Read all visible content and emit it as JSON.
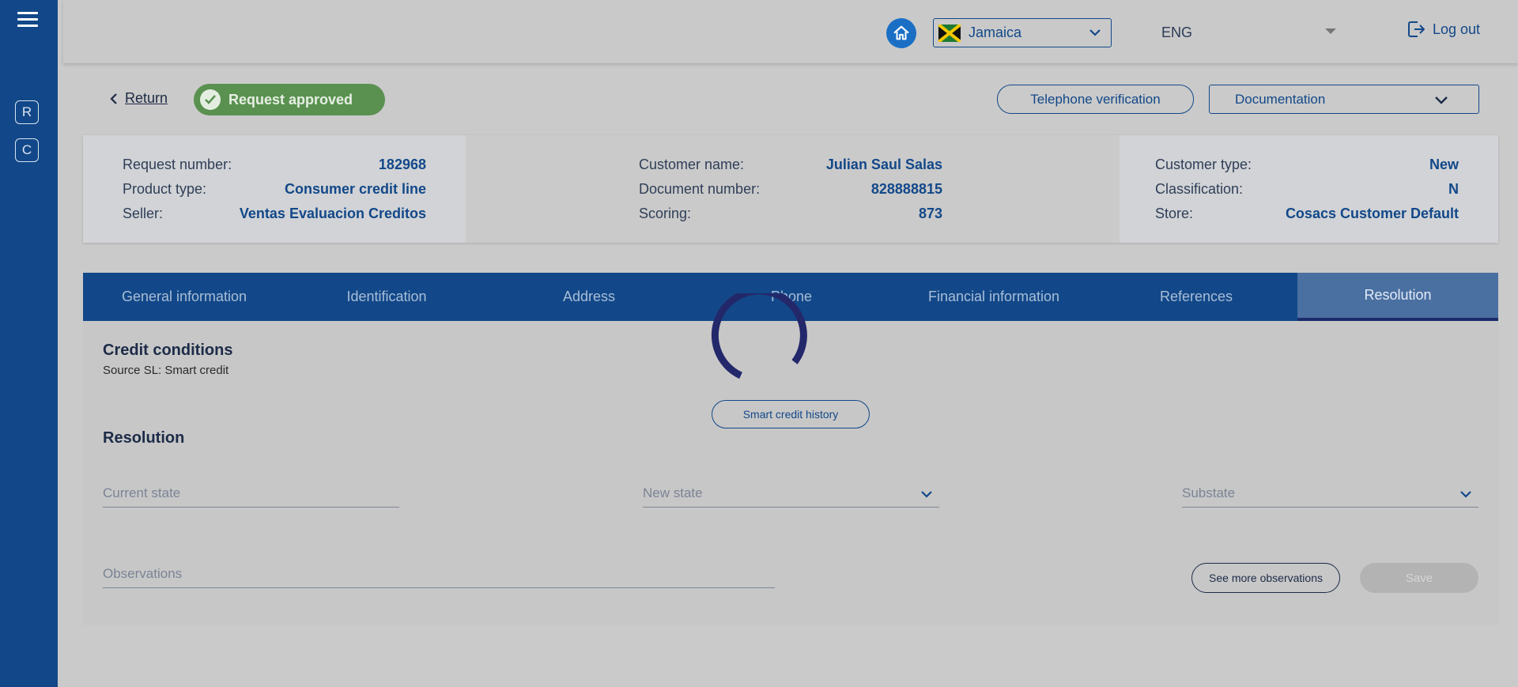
{
  "sidebar": {
    "items": [
      {
        "label": "R"
      },
      {
        "label": "C"
      }
    ]
  },
  "header": {
    "country": "Jamaica",
    "language": "ENG",
    "logout_label": "Log out"
  },
  "subheader": {
    "return_label": "Return",
    "status_badge": "Request approved",
    "telephone_verification_label": "Telephone verification",
    "documentation_label": "Documentation"
  },
  "info": {
    "left": [
      {
        "label": "Request number:",
        "value": "182968"
      },
      {
        "label": "Product type:",
        "value": "Consumer credit line"
      },
      {
        "label": "Seller:",
        "value": "Ventas Evaluacion Creditos"
      }
    ],
    "center": [
      {
        "label": "Customer name:",
        "value": "Julian Saul Salas"
      },
      {
        "label": "Document number:",
        "value": "828888815"
      },
      {
        "label": "Scoring:",
        "value": "873"
      }
    ],
    "right": [
      {
        "label": "Customer type:",
        "value": "New"
      },
      {
        "label": "Classification:",
        "value": "N"
      },
      {
        "label": "Store:",
        "value": "Cosacs Customer Default"
      }
    ]
  },
  "tabs": [
    {
      "label": "General information"
    },
    {
      "label": "Identification"
    },
    {
      "label": "Address"
    },
    {
      "label": "Phone"
    },
    {
      "label": "Financial information"
    },
    {
      "label": "References"
    },
    {
      "label": "Resolution"
    }
  ],
  "credit_conditions": {
    "title": "Credit conditions",
    "source": "Source SL: Smart credit",
    "history_button": "Smart credit history"
  },
  "resolution": {
    "title": "Resolution",
    "current_state_placeholder": "Current state",
    "new_state_placeholder": "New state",
    "substate_placeholder": "Substate",
    "observations_placeholder": "Observations",
    "see_more_label": "See more observations",
    "save_label": "Save"
  },
  "colors": {
    "primary": "#124889",
    "approved": "#5a9150",
    "home": "#1a6fc5"
  }
}
